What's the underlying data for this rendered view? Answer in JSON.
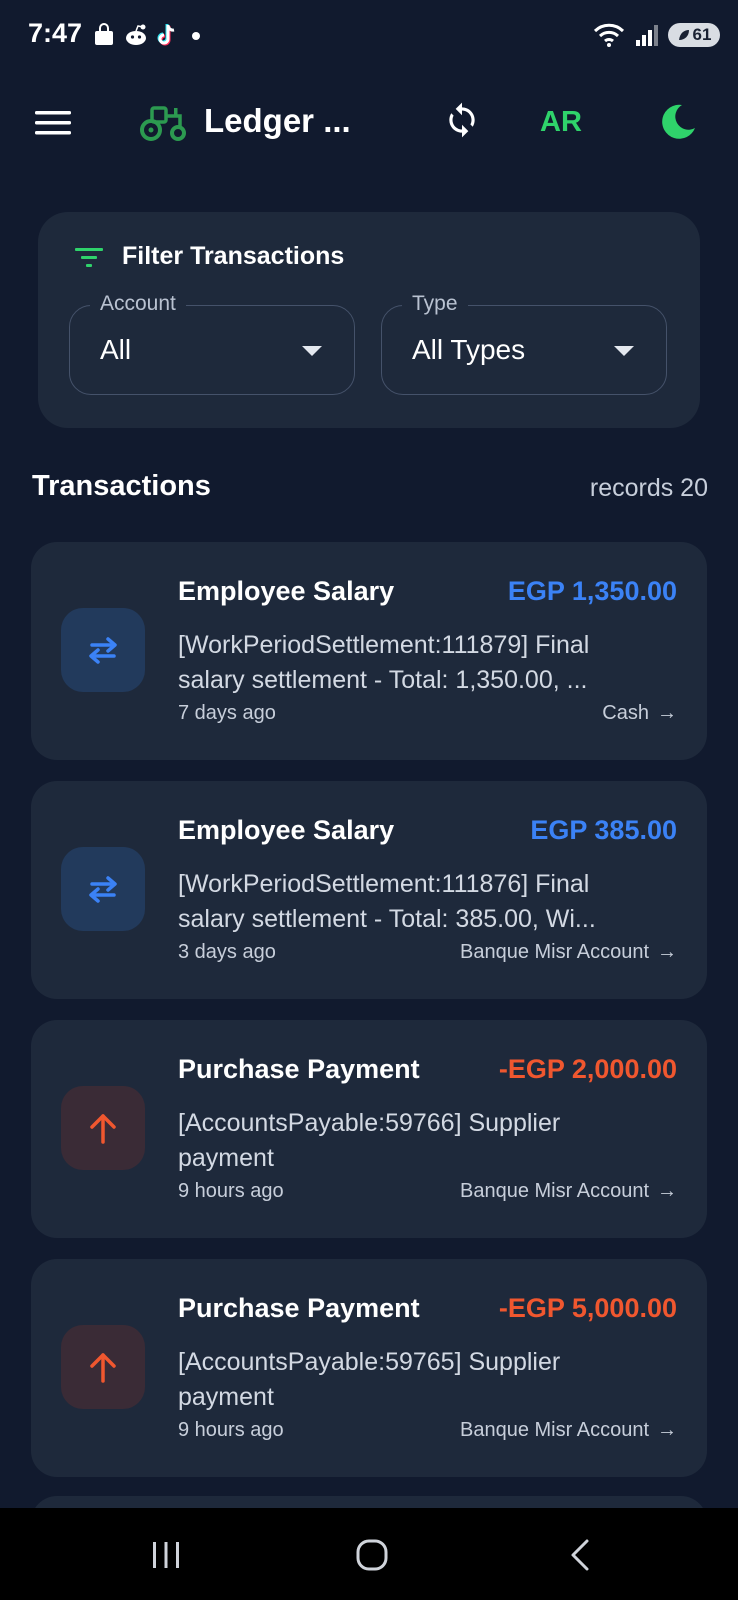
{
  "status_bar": {
    "time": "7:47",
    "battery": "61",
    "notification_icons": [
      "shopping-bag-icon",
      "reddit-icon",
      "tiktok-icon",
      "dot-icon"
    ]
  },
  "app_bar": {
    "title": "Ledger ...",
    "language": "AR"
  },
  "filter": {
    "title": "Filter Transactions",
    "account": {
      "label": "Account",
      "value": "All"
    },
    "type": {
      "label": "Type",
      "value": "All Types"
    }
  },
  "transactions": {
    "title": "Transactions",
    "records": "records 20",
    "items": [
      {
        "title": "Employee Salary",
        "amount": "EGP 1,350.00",
        "description": "[WorkPeriodSettlement:111879] Final\nsalary settlement - Total: 1,350.00, ...",
        "date": "7 days ago",
        "account": "Cash",
        "arrow": "→",
        "kind": "transfer"
      },
      {
        "title": "Employee Salary",
        "amount": "EGP 385.00",
        "description": "[WorkPeriodSettlement:111876] Final\nsalary settlement - Total: 385.00, Wi...",
        "date": "3 days ago",
        "account": "Banque Misr Account",
        "arrow": "→",
        "kind": "transfer"
      },
      {
        "title": "Purchase Payment",
        "amount": "-EGP 2,000.00",
        "description": "[AccountsPayable:59766] Supplier\npayment",
        "date": "9 hours ago",
        "account": "Banque Misr Account",
        "arrow": "→",
        "kind": "payment"
      },
      {
        "title": "Purchase Payment",
        "amount": "-EGP 5,000.00",
        "description": "[AccountsPayable:59765] Supplier\npayment",
        "date": "9 hours ago",
        "account": "Banque Misr Account",
        "arrow": "→",
        "kind": "payment"
      }
    ]
  },
  "colors": {
    "background": "#111a2e",
    "card": "#1e293b",
    "accent_green": "#2fd36b",
    "transfer_blue": "#3b82f6",
    "payment_red": "#f0572f"
  }
}
